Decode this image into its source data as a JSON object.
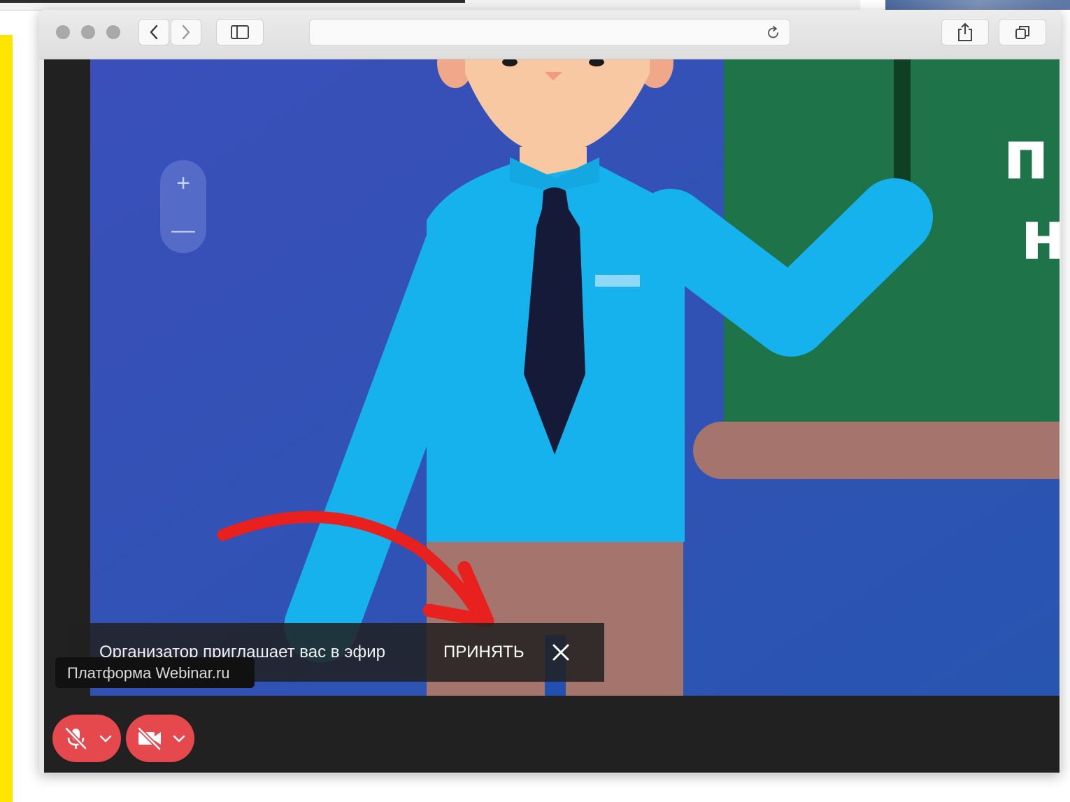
{
  "browser": {
    "url": "",
    "buttons": {
      "back": "chevron-left-icon",
      "forward": "chevron-right-icon",
      "sidebar": "sidebar-icon",
      "reload": "reload-icon",
      "share": "share-icon",
      "tabs": "tabs-icon"
    }
  },
  "stage": {
    "board_text": [
      "п",
      "н"
    ],
    "zoom": {
      "in_label": "+",
      "out_label": "—"
    }
  },
  "notification": {
    "message": "Организатор приглашает вас в эфир",
    "accept_label": "ПРИНЯТЬ",
    "close_icon": "close-icon"
  },
  "platform_label": "Платформа Webinar.ru",
  "controls": {
    "microphone": {
      "icon": "microphone-muted-icon",
      "state": "muted"
    },
    "camera": {
      "icon": "camera-off-icon",
      "state": "off"
    }
  },
  "colors": {
    "accent_red": "#E5484D",
    "stage_blue": "#3A55B8",
    "board_green": "#1E7349",
    "shirt_blue": "#16B2EE",
    "tie": "#151A38",
    "desk": "#A5746C",
    "annotation_arrow": "#E8201E"
  }
}
